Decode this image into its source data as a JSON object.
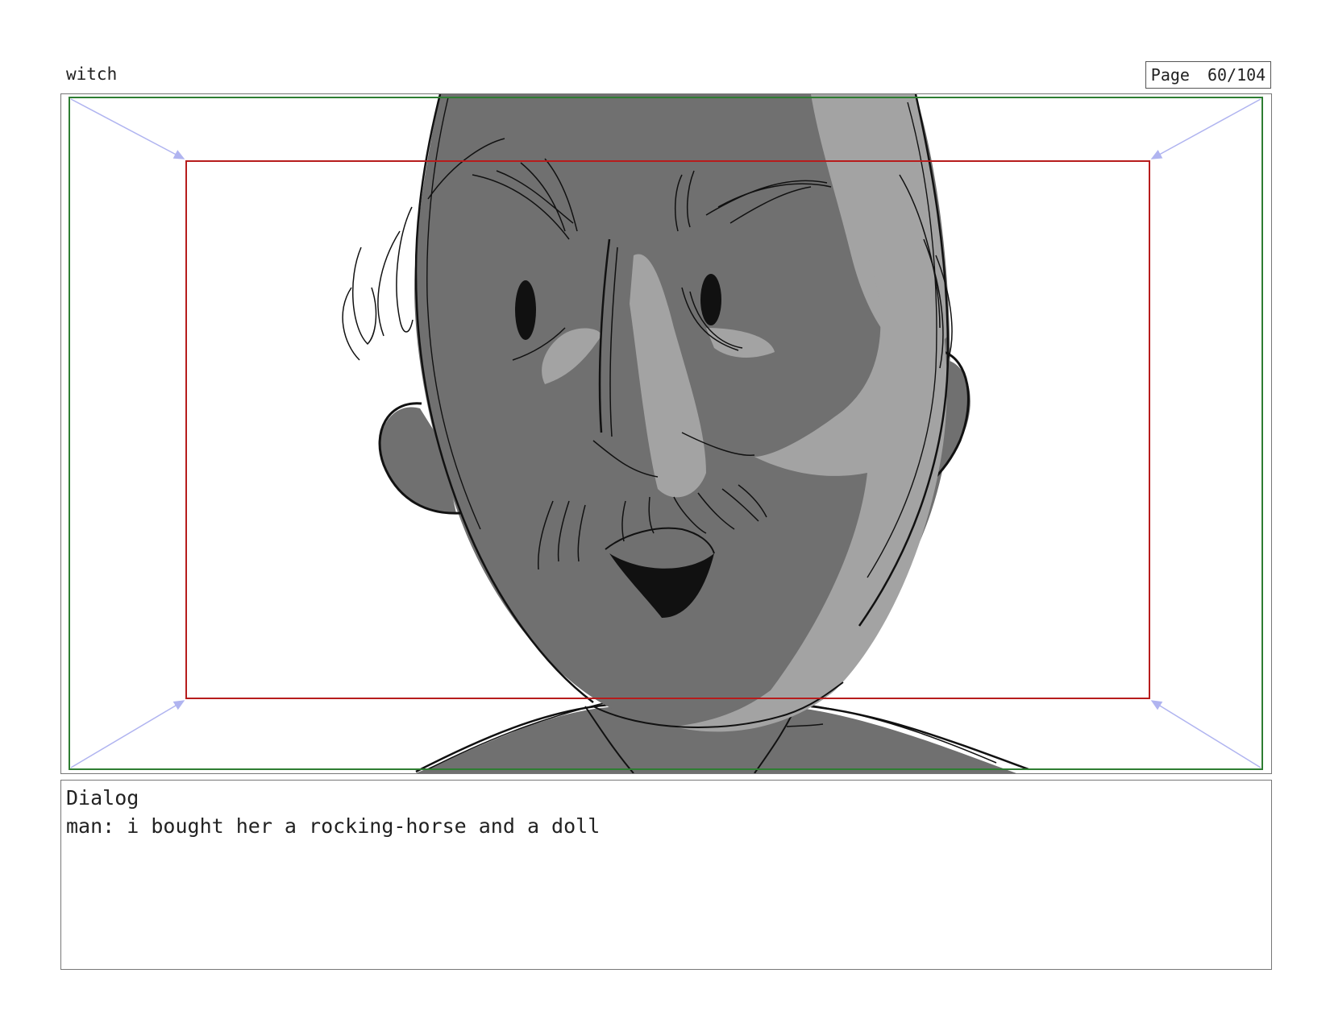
{
  "header": {
    "project_title": "witch",
    "page_label": "Page",
    "page_number": "60/104"
  },
  "panel": {
    "frame_colors": {
      "outer_field": "#2e7d32",
      "inner_field": "#b71c1c",
      "camera_arrows": "#b0b4f0"
    },
    "shading_colors": {
      "dark_tone": "#707070",
      "light_tone": "#a3a3a3",
      "ink": "#111111"
    }
  },
  "dialog": {
    "heading": "Dialog",
    "lines": [
      "man: i bought her a rocking-horse and a doll"
    ]
  }
}
